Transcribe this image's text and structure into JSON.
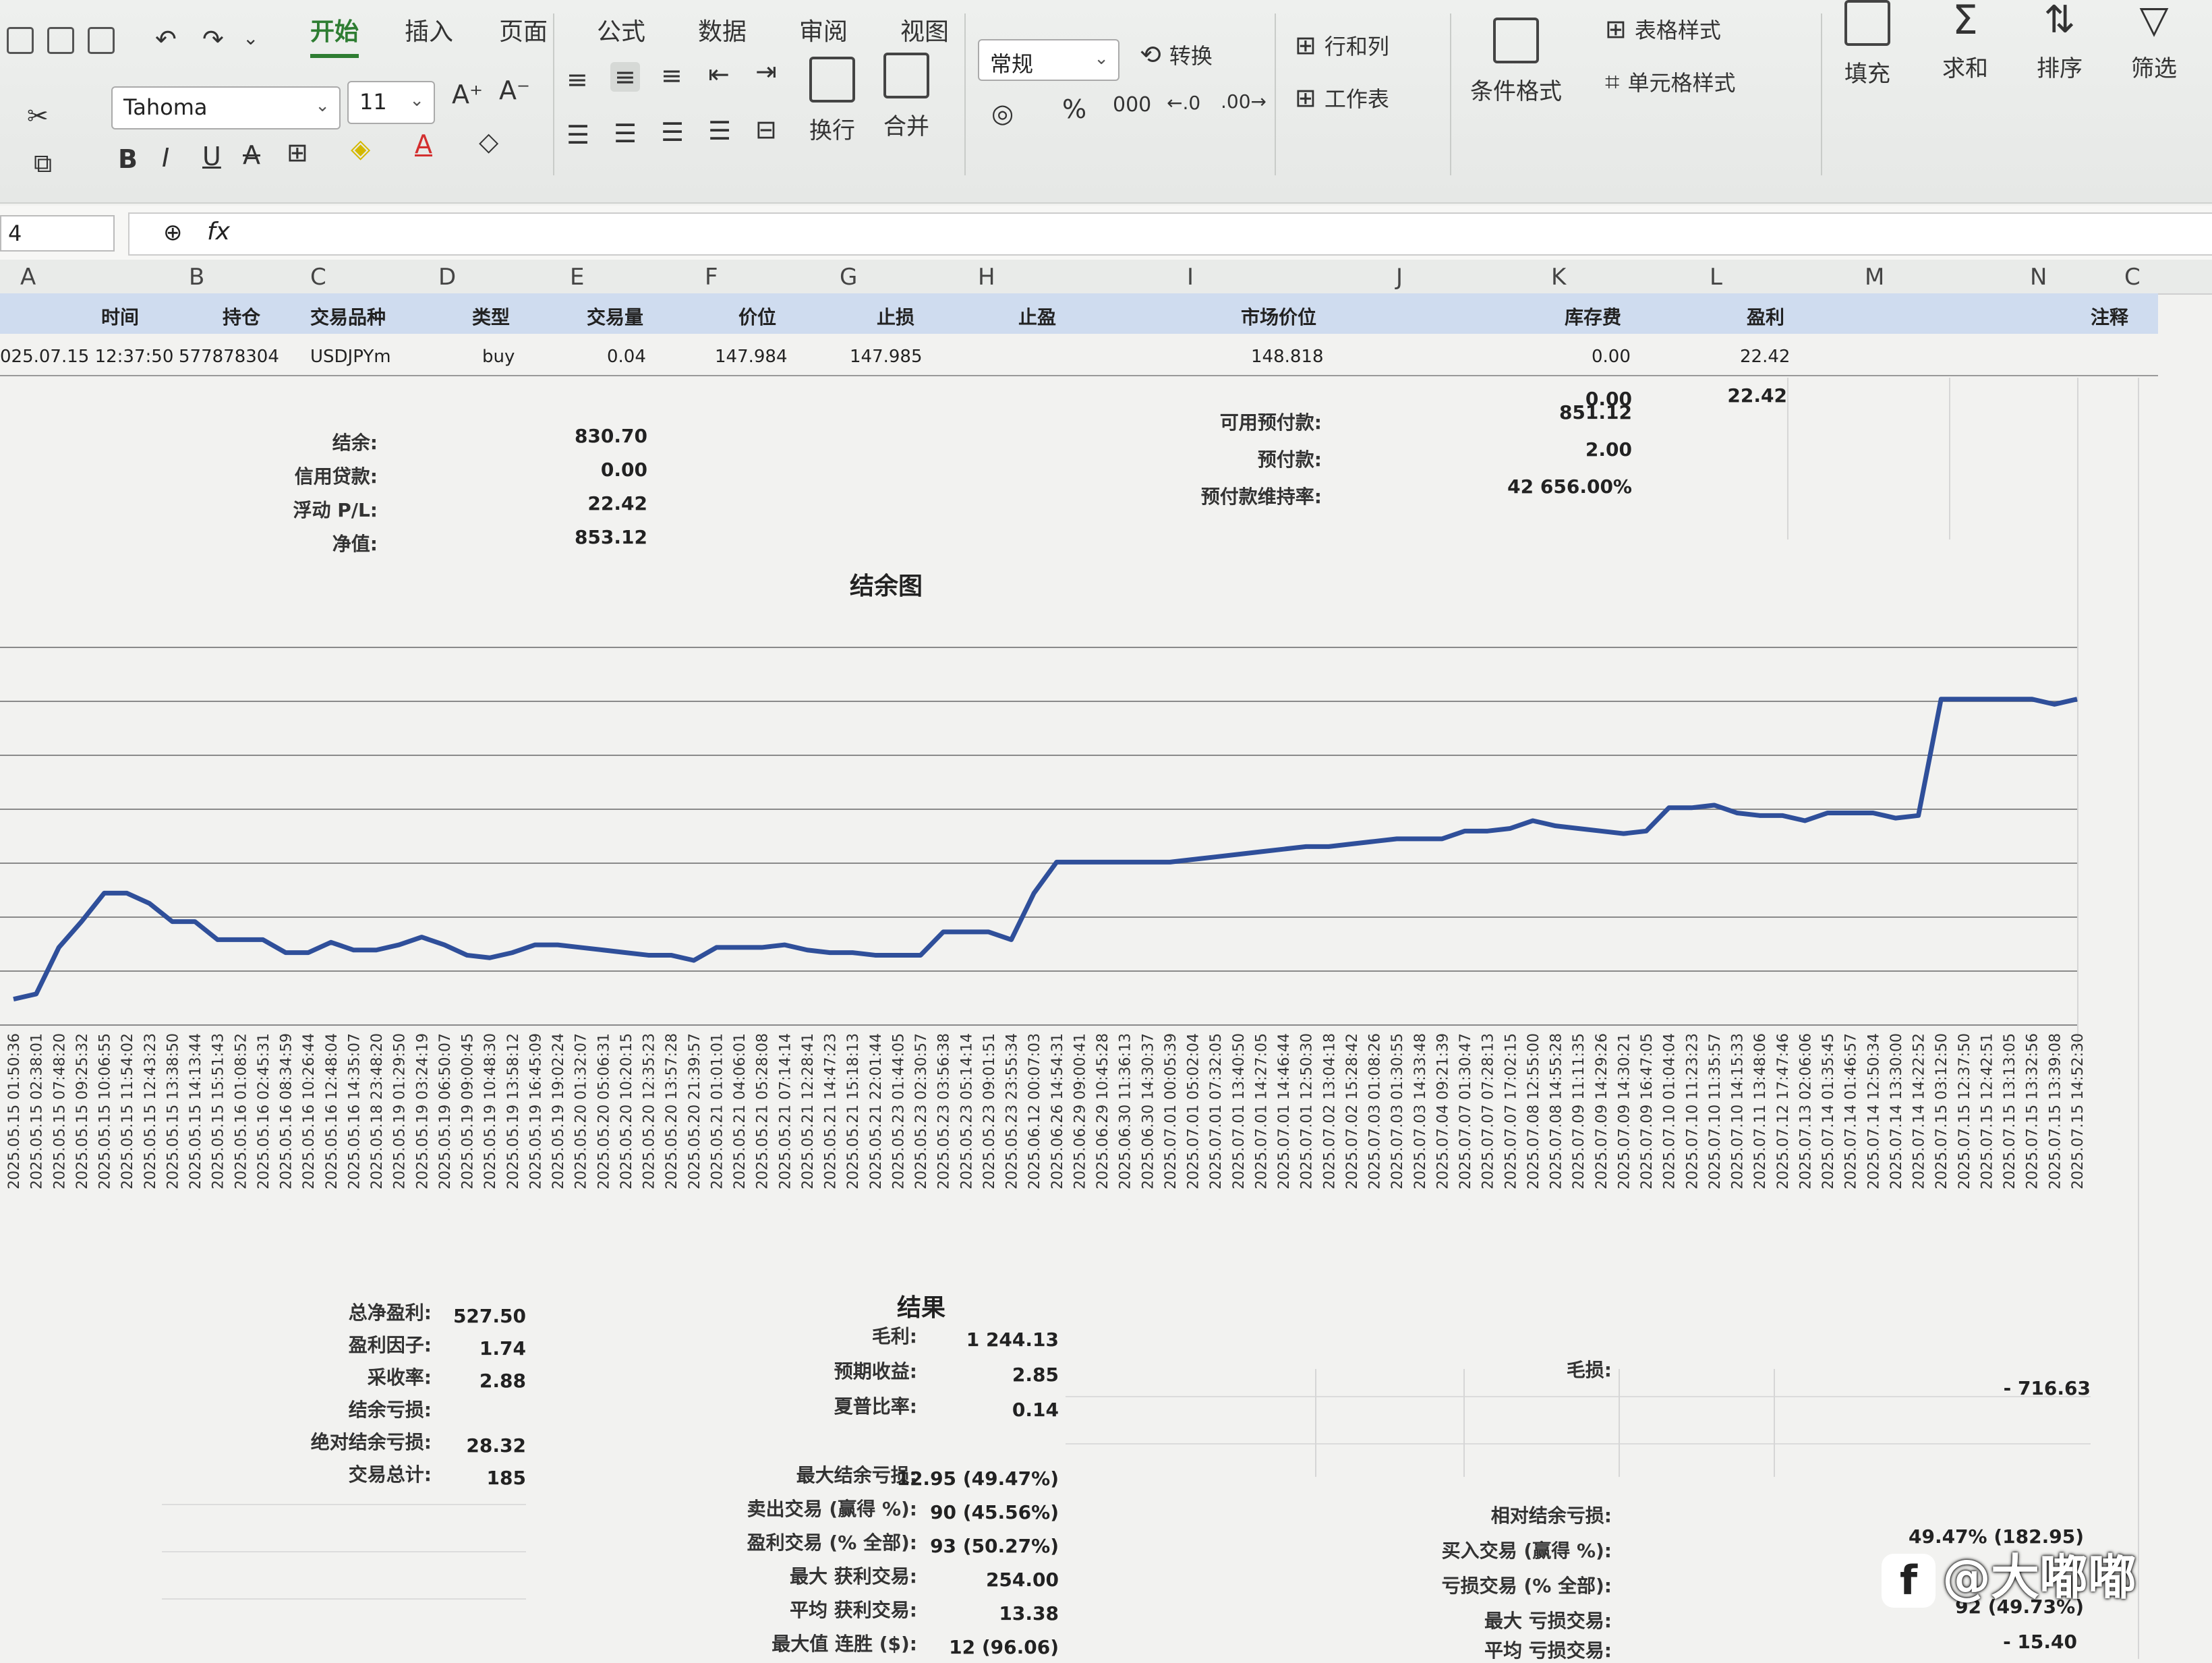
{
  "menu_tabs": [
    "开始",
    "插入",
    "页面",
    "公式",
    "数据",
    "审阅",
    "视图"
  ],
  "toolbar": {
    "font_name": "Tahoma",
    "font_size": "11",
    "number_format": "常规",
    "wrap_label": "换行",
    "merge_label": "合并",
    "convert_label": "转换",
    "rows_cols_label": "行和列",
    "worksheet_label": "工作表",
    "cond_format_label": "条件格式",
    "table_style_label": "表格样式",
    "cell_style_label": "单元格样式",
    "fill_label": "填充",
    "sum_label": "求和",
    "sort_label": "排序",
    "filter_label": "筛选",
    "percent": "%",
    "thousands": "000"
  },
  "name_box": "4",
  "columns": [
    "A",
    "B",
    "C",
    "D",
    "E",
    "F",
    "G",
    "H",
    "I",
    "J",
    "K",
    "L",
    "M",
    "N",
    "C"
  ],
  "positions": {
    "headers": [
      "时间",
      "持仓",
      "交易品种",
      "类型",
      "交易量",
      "价位",
      "止损",
      "止盈",
      "市场价位",
      "库存费",
      "盈利",
      "注释"
    ],
    "row": [
      "025.07.15 12:37:50",
      "577878304",
      "USDJPYm",
      "buy",
      "0.04",
      "147.984",
      "147.985",
      "",
      "148.818",
      "0.00",
      "22.42",
      ""
    ],
    "totals": {
      "swap": "0.00",
      "profit": "22.42"
    }
  },
  "account": {
    "left": [
      {
        "label": "结余:",
        "value": "830.70"
      },
      {
        "label": "信用贷款:",
        "value": "0.00"
      },
      {
        "label": "浮动 P/L:",
        "value": "22.42"
      },
      {
        "label": "净值:",
        "value": "853.12"
      }
    ],
    "right": [
      {
        "label": "可用预付款:",
        "value": "851.12"
      },
      {
        "label": "预付款:",
        "value": "2.00"
      },
      {
        "label": "预付款维持率:",
        "value": "42 656.00%"
      }
    ]
  },
  "chart_data": {
    "type": "line",
    "title": "结余图",
    "x": [
      "2025.05.15 01:50:36",
      "2025.05.15 02:38:01",
      "2025.05.15 07:48:20",
      "2025.05.15 09:25:32",
      "2025.05.15 10:06:55",
      "2025.05.15 11:54:02",
      "2025.05.15 12:43:23",
      "2025.05.15 13:38:50",
      "2025.05.15 14:13:44",
      "2025.05.15 15:51:43",
      "2025.05.16 01:08:52",
      "2025.05.16 02:45:31",
      "2025.05.16 08:34:59",
      "2025.05.16 10:26:44",
      "2025.05.16 12:48:04",
      "2025.05.16 14:35:07",
      "2025.05.18 23:48:20",
      "2025.05.19 01:29:50",
      "2025.05.19 03:24:19",
      "2025.05.19 06:50:07",
      "2025.05.19 09:00:45",
      "2025.05.19 10:48:30",
      "2025.05.19 13:58:12",
      "2025.05.19 16:45:09",
      "2025.05.19 19:02:24",
      "2025.05.20 01:32:07",
      "2025.05.20 05:06:31",
      "2025.05.20 10:20:15",
      "2025.05.20 12:35:23",
      "2025.05.20 13:57:28",
      "2025.05.20 21:39:57",
      "2025.05.21 01:01:01",
      "2025.05.21 04:06:01",
      "2025.05.21 05:28:08",
      "2025.05.21 07:14:14",
      "2025.05.21 12:28:41",
      "2025.05.21 14:47:23",
      "2025.05.21 15:18:13",
      "2025.05.21 22:01:44",
      "2025.05.23 01:44:05",
      "2025.05.23 02:30:57",
      "2025.05.23 03:56:38",
      "2025.05.23 05:14:14",
      "2025.05.23 09:01:51",
      "2025.05.23 23:55:34",
      "2025.06.12 00:07:03",
      "2025.06.26 14:54:31",
      "2025.06.29 09:00:41",
      "2025.06.29 10:45:28",
      "2025.06.30 11:36:13",
      "2025.06.30 14:30:37",
      "2025.07.01 00:05:39",
      "2025.07.01 05:02:04",
      "2025.07.01 07:32:05",
      "2025.07.01 13:40:50",
      "2025.07.01 14:27:05",
      "2025.07.01 14:46:44",
      "2025.07.01 12:50:30",
      "2025.07.02 13:04:18",
      "2025.07.02 15:28:42",
      "2025.07.03 01:08:26",
      "2025.07.03 01:30:55",
      "2025.07.03 14:33:48",
      "2025.07.04 09:21:39",
      "2025.07.07 01:30:47",
      "2025.07.07 07:28:13",
      "2025.07.07 17:02:15",
      "2025.07.08 12:55:00",
      "2025.07.08 14:55:28",
      "2025.07.09 11:11:35",
      "2025.07.09 14:29:26",
      "2025.07.09 14:30:21",
      "2025.07.09 16:47:05",
      "2025.07.10 01:04:04",
      "2025.07.10 11:23:23",
      "2025.07.10 11:35:57",
      "2025.07.10 14:15:33",
      "2025.07.11 13:48:06",
      "2025.07.12 17:47:46",
      "2025.07.13 02:06:06",
      "2025.07.14 01:35:45",
      "2025.07.14 01:46:57",
      "2025.07.14 12:50:34",
      "2025.07.14 13:30:00",
      "2025.07.14 14:22:52",
      "2025.07.15 03:12:50",
      "2025.07.15 12:37:50",
      "2025.07.15 12:42:51",
      "2025.07.15 13:13:05",
      "2025.07.15 13:32:56",
      "2025.07.15 13:39:08",
      "2025.07.15 14:52:30"
    ],
    "values": [
      304,
      306,
      324,
      334,
      345,
      345,
      341,
      334,
      334,
      327,
      327,
      327,
      322,
      322,
      326,
      323,
      323,
      325,
      328,
      325,
      321,
      320,
      322,
      325,
      325,
      324,
      323,
      322,
      321,
      321,
      319,
      324,
      324,
      324,
      325,
      323,
      322,
      322,
      321,
      321,
      321,
      330,
      330,
      330,
      327,
      345,
      357,
      357,
      357,
      357,
      357,
      357,
      358,
      359,
      360,
      361,
      362,
      363,
      363,
      364,
      365,
      366,
      366,
      366,
      369,
      369,
      370,
      373,
      371,
      370,
      369,
      368,
      369,
      378,
      378,
      379,
      376,
      375,
      375,
      373,
      376,
      376,
      376,
      374,
      375,
      420,
      420,
      420,
      420,
      420,
      418,
      420
    ],
    "xlabel": "",
    "ylabel": "",
    "grid": true,
    "color": "#2f4f9a"
  },
  "results": {
    "title": "结果",
    "left": [
      {
        "label": "总净盈利:",
        "value": "527.50"
      },
      {
        "label": "盈利因子:",
        "value": "1.74"
      },
      {
        "label": "采收率:",
        "value": "2.88"
      },
      {
        "label": "结余亏损:",
        "value": ""
      },
      {
        "label": "绝对结余亏损:",
        "value": "28.32"
      },
      {
        "label": "交易总计:",
        "value": "185"
      }
    ],
    "middle": [
      {
        "label": "毛利:",
        "value": "1 244.13"
      },
      {
        "label": "预期收益:",
        "value": "2.85"
      },
      {
        "label": "夏普比率:",
        "value": "0.14"
      },
      {
        "label": "最大结余亏损:",
        "value": "12.95 (49.47%)"
      },
      {
        "label": "卖出交易 (赢得 %):",
        "value": "90 (45.56%)"
      },
      {
        "label": "盈利交易 (% 全部):",
        "value": "93 (50.27%)"
      },
      {
        "label": "最大 获利交易:",
        "value": "254.00"
      },
      {
        "label": "平均 获利交易:",
        "value": "13.38"
      },
      {
        "label": "最大值 连胜 ($):",
        "value": "12 (96.06)"
      }
    ],
    "right": [
      {
        "label": "毛损:",
        "value": "- 716.63"
      },
      {
        "label": "相对结余亏损:",
        "value": "49.47% (182.95)"
      },
      {
        "label": "买入交易 (赢得 %):",
        "value": ""
      },
      {
        "label": "亏损交易 (% 全部):",
        "value": "92 (49.73%)"
      },
      {
        "label": "最大 亏损交易:",
        "value": "- 15.40"
      },
      {
        "label": "平均 亏损交易:",
        "value": ""
      }
    ]
  },
  "watermark": {
    "logo": "f",
    "text": "@大嘟嘟"
  }
}
